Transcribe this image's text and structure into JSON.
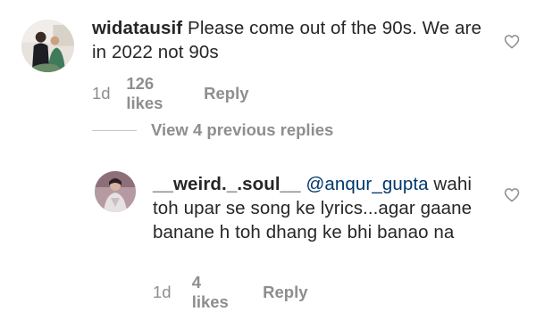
{
  "comments": [
    {
      "username": "widatausif",
      "text": " Please come out of the 90s. We are in 2022 not 90s",
      "time": "1d",
      "likes": "126 likes",
      "reply_label": "Reply"
    }
  ],
  "view_replies": {
    "label": "View 4 previous replies"
  },
  "replies": [
    {
      "username": "__weird._.soul__",
      "mention": "@anqur_gupta",
      "text": " wahi toh upar se song ke lyrics...agar gaane banane h toh dhang ke bhi banao na",
      "time": "1d",
      "likes": "4 likes",
      "reply_label": "Reply"
    }
  ],
  "icons": {
    "like": "heart-outline-icon"
  },
  "colors": {
    "text": "#262626",
    "secondary": "#8e8e8e",
    "mention": "#00376b",
    "divider": "#c7c7c7"
  }
}
